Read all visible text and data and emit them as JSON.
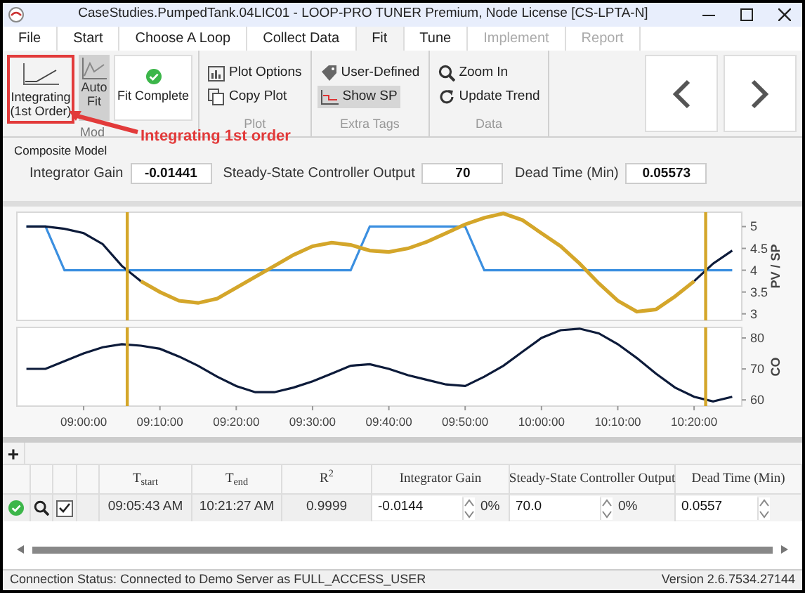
{
  "window": {
    "title": "CaseStudies.PumpedTank.04LIC01 - LOOP-PRO TUNER Premium, Node License [CS-LPTA-N]"
  },
  "tabs": [
    {
      "label": "File",
      "selected": false,
      "disabled": false
    },
    {
      "label": "Start",
      "selected": false,
      "disabled": false
    },
    {
      "label": "Choose A Loop",
      "selected": false,
      "disabled": false
    },
    {
      "label": "Collect Data",
      "selected": false,
      "disabled": false
    },
    {
      "label": "Fit",
      "selected": true,
      "disabled": false
    },
    {
      "label": "Tune",
      "selected": false,
      "disabled": false
    },
    {
      "label": "Implement",
      "selected": false,
      "disabled": true
    },
    {
      "label": "Report",
      "selected": false,
      "disabled": true
    }
  ],
  "ribbon": {
    "model_group": {
      "label": "Mod",
      "model_button": "Integrating\n(1st Order)",
      "auto_fit": {
        "label": "Auto\nFit",
        "selected": true
      },
      "status": "Fit Complete"
    },
    "plot_group": {
      "label": "Plot",
      "items": [
        {
          "label": "Plot Options",
          "kind": "chart",
          "selected": false
        },
        {
          "label": "Copy Plot",
          "kind": "copy",
          "selected": false
        }
      ]
    },
    "tags_group": {
      "label": "Extra Tags",
      "items": [
        {
          "label": "User-Defined",
          "kind": "tag",
          "selected": false
        },
        {
          "label": "Show SP",
          "kind": "sp",
          "selected": true
        }
      ]
    },
    "data_group": {
      "label": "Data",
      "items": [
        {
          "label": "Zoom In",
          "kind": "zoom",
          "selected": false
        },
        {
          "label": "Update Trend",
          "kind": "refresh",
          "selected": false
        }
      ]
    }
  },
  "annotation": "Integrating 1st order",
  "composite_model": {
    "title": "Composite Model",
    "fields": [
      {
        "label": "Integrator Gain",
        "value": "-0.01441"
      },
      {
        "label": "Steady-State Controller Output",
        "value": "70"
      },
      {
        "label": "Dead Time (Min)",
        "value": "0.05573"
      }
    ]
  },
  "charts": [
    {
      "chart_data": {
        "type": "line",
        "ylabel": "PV / SP",
        "ylim": [
          2.85,
          5.33
        ],
        "yticks": [
          3,
          3.5,
          4,
          4.5,
          5
        ],
        "categories": [
          null,
          null,
          null,
          null,
          null,
          null,
          null,
          null,
          null,
          null,
          null,
          null,
          null,
          null,
          null,
          null,
          null,
          null,
          null,
          null,
          null,
          null,
          null,
          null,
          null,
          null,
          null,
          null,
          null,
          null,
          null,
          null,
          null,
          null,
          null,
          null,
          null,
          null
        ],
        "series": [
          {
            "color": "#3b8fe0",
            "values": [
              5,
              5,
              4,
              4,
              4,
              4,
              4,
              4,
              4,
              4,
              4,
              4,
              4,
              4,
              4,
              4,
              4,
              4,
              5,
              5,
              5,
              5,
              5,
              5,
              4,
              4,
              4,
              4,
              4,
              4,
              4,
              4,
              4,
              4,
              4,
              4,
              4,
              4
            ]
          },
          {
            "color": "#0d1b3a",
            "values": [
              5,
              5,
              4.95,
              4.85,
              4.6,
              4.1,
              3.75,
              null,
              null,
              null,
              null,
              null,
              null,
              null,
              null,
              null,
              null,
              null,
              null,
              null,
              null,
              null,
              null,
              null,
              null,
              null,
              null,
              null,
              null,
              null,
              null,
              null,
              null,
              null,
              null,
              3.75,
              4.15,
              4.45
            ]
          },
          {
            "color": "#d4a62a",
            "values": [
              null,
              null,
              null,
              null,
              null,
              null,
              3.75,
              3.5,
              3.3,
              3.25,
              3.35,
              3.6,
              3.85,
              4.1,
              4.35,
              4.55,
              4.63,
              4.58,
              4.45,
              4.42,
              4.5,
              4.65,
              4.85,
              5.05,
              5.2,
              5.3,
              5.15,
              4.85,
              4.55,
              4.15,
              3.7,
              3.3,
              3.05,
              3.1,
              3.4,
              3.75,
              null,
              null
            ]
          }
        ]
      }
    },
    {
      "chart_data": {
        "type": "line",
        "ylabel": "CO",
        "ylim": [
          58,
          83.4
        ],
        "yticks": [
          60,
          70,
          80
        ],
        "categories": [
          null,
          null,
          null,
          "09:00:00",
          null,
          null,
          null,
          "09:10:00",
          null,
          null,
          null,
          "09:20:00",
          null,
          null,
          null,
          "09:30:00",
          null,
          null,
          null,
          "09:40:00",
          null,
          null,
          null,
          "09:50:00",
          null,
          null,
          null,
          "10:00:00",
          null,
          null,
          null,
          "10:10:00",
          null,
          null,
          null,
          "10:20:00",
          null,
          null
        ],
        "series": [
          {
            "color": "#0d1b3a",
            "values": [
              70,
              70,
              72.5,
              75,
              77,
              78,
              77.5,
              76.5,
              74,
              71,
              67.5,
              64.5,
              62.5,
              62.5,
              64,
              66,
              68.5,
              71,
              71.5,
              70,
              68,
              66.5,
              65,
              64.5,
              67.5,
              71,
              75.5,
              80,
              82.5,
              83,
              81.5,
              78,
              73.5,
              68.5,
              64,
              61,
              59.5,
              61
            ]
          }
        ]
      }
    }
  ],
  "table": {
    "add_button": "+",
    "columns": [
      {
        "label": "T$_{start}$"
      },
      {
        "label": "T$_{end}$"
      },
      {
        "label": "R$^{2}$"
      },
      {
        "label": "Integrator Gain"
      },
      {
        "label": "Steady-State Controller Output"
      },
      {
        "label": "Dead Time (Min)"
      }
    ],
    "rows": [
      {
        "checked": true,
        "cells": [
          {
            "kind": "text",
            "value": "09:05:43 AM"
          },
          {
            "kind": "text",
            "value": "10:21:27 AM"
          },
          {
            "kind": "text",
            "value": "0.9999"
          },
          {
            "kind": "spin",
            "value": "-0.0144",
            "pct": "0%"
          },
          {
            "kind": "spin",
            "value": "70.0",
            "pct": "0%"
          },
          {
            "kind": "spin",
            "value": "0.0557"
          }
        ]
      }
    ]
  },
  "status_bar": {
    "connection": "Connection Status: Connected to Demo Server as FULL_ACCESS_USER",
    "version": "Version 2.6.7534.27144"
  }
}
